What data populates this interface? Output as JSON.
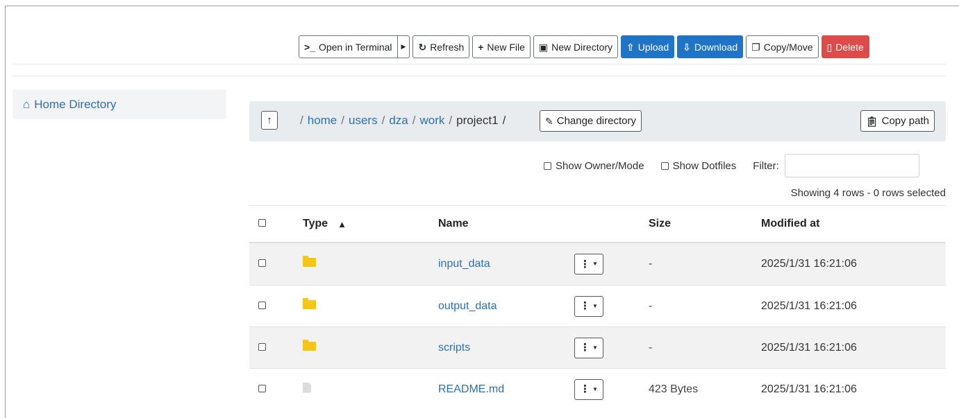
{
  "toolbar": {
    "open_terminal": "Open in Terminal",
    "refresh": "Refresh",
    "new_file": "New File",
    "new_directory": "New Directory",
    "upload": "Upload",
    "download": "Download",
    "copy_move": "Copy/Move",
    "delete": "Delete"
  },
  "sidebar": {
    "items": [
      {
        "label": "Home Directory",
        "icon": "home-icon"
      }
    ]
  },
  "breadcrumb": {
    "segments": [
      "home",
      "users",
      "dza",
      "work"
    ],
    "current": "project1",
    "separator": "/"
  },
  "actions": {
    "change_directory": "Change directory",
    "copy_path": "Copy path"
  },
  "options": {
    "show_owner_mode": "Show Owner/Mode",
    "show_dotfiles": "Show Dotfiles",
    "filter_label": "Filter:",
    "filter_value": ""
  },
  "status": {
    "rows_info": "Showing 4 rows - 0 rows selected"
  },
  "table": {
    "columns": {
      "type": "Type",
      "name": "Name",
      "size": "Size",
      "modified": "Modified at"
    },
    "sort": {
      "column": "type",
      "direction": "ascending"
    },
    "rows": [
      {
        "type": "folder",
        "name": "input_data",
        "size": "-",
        "modified": "2025/1/31 16:21:06"
      },
      {
        "type": "folder",
        "name": "output_data",
        "size": "-",
        "modified": "2025/1/31 16:21:06"
      },
      {
        "type": "folder",
        "name": "scripts",
        "size": "-",
        "modified": "2025/1/31 16:21:06"
      },
      {
        "type": "file",
        "name": "README.md",
        "size": "423 Bytes",
        "modified": "2025/1/31 16:21:06"
      }
    ]
  },
  "colors": {
    "primary": "#1f74c7",
    "danger": "#de4b4b",
    "link": "#2d6fb4",
    "folder": "#f5c518"
  }
}
